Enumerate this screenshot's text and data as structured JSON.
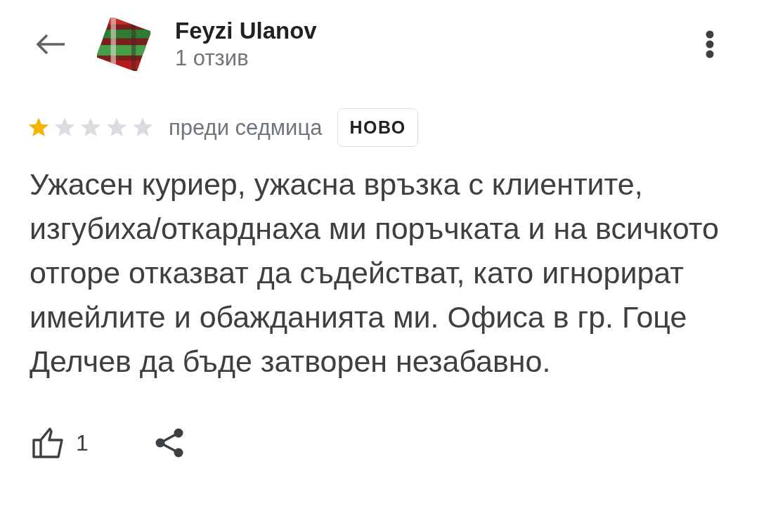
{
  "header": {
    "name": "Feyzi Ulanov",
    "review_count": "1 отзив"
  },
  "review": {
    "stars": 1,
    "time": "преди седмица",
    "badge": "НОВО",
    "text": "Ужасен куриер, ужасна връзка с клиентите, изгубиха/откарднаха ми поръчката и на всичкото отгоре отказват да съдействат, като игнорират имейлите и обажданията ми. Офиса в гр. Гоце Делчев да бъде затворен незабавно.",
    "likes": "1"
  }
}
